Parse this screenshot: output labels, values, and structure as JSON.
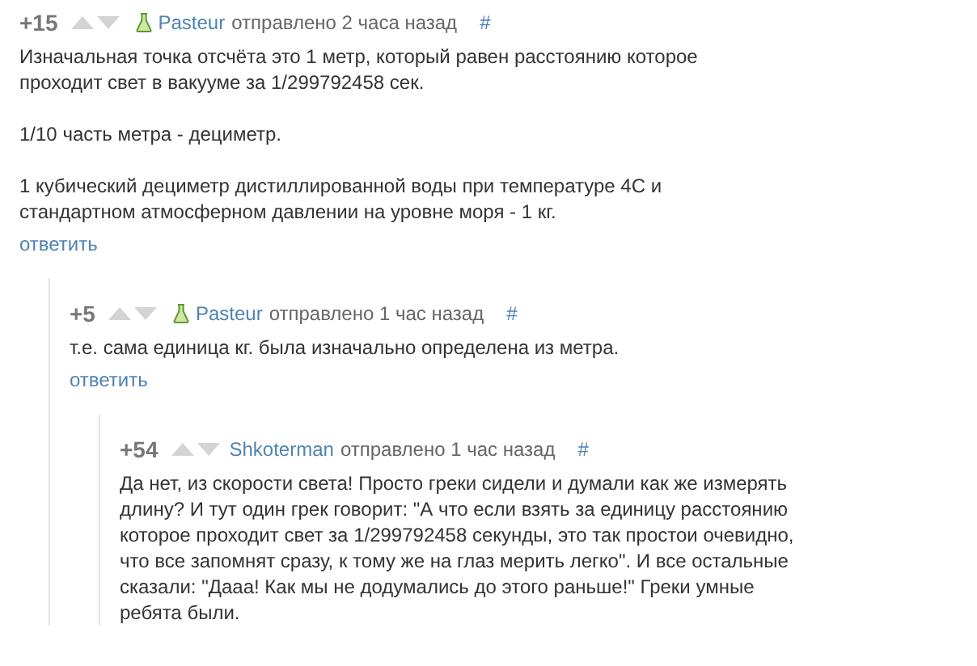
{
  "comments": [
    {
      "rating": "+15",
      "flask_badge": true,
      "author": "Pasteur",
      "time": "отправлено 2 часа назад",
      "anchor": "#",
      "paragraphs": [
        "Изначальная точка отсчёта это 1 метр, который равен расстоянию которое проходит свет в вакууме за 1/299792458 сек.",
        "1/10 часть метра - дециметр.",
        "1 кубический дециметр дистиллированной воды при температуре 4С и стандартном атмосферном давлении на уровне моря - 1 кг."
      ],
      "reply": "ответить",
      "children": [
        {
          "rating": "+5",
          "flask_badge": true,
          "author": "Pasteur",
          "time": "отправлено 1 час назад",
          "anchor": "#",
          "paragraphs": [
            "т.е. сама единица кг. была изначально определена из метра."
          ],
          "reply": "ответить",
          "children": [
            {
              "rating": "+54",
              "author": "Shkoterman",
              "time": "отправлено 1 час назад",
              "anchor": "#",
              "paragraphs": [
                "Да нет, из скорости света! Просто греки сидели и думали как же измерять длину? И тут один грек говорит: \"А что если взять за единицу расстоянию которое проходит свет за 1/299792458 секунды, это так простои очевидно, что все запомнят сразу, к тому же на глаз мерить легко\". И все остальные сказали: \"Дааа! Как мы не додумались до этого раньше!\" Греки умные ребята были."
              ]
            }
          ]
        }
      ]
    }
  ]
}
